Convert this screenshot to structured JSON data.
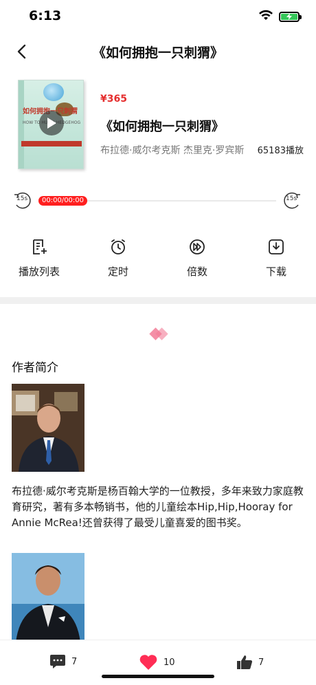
{
  "status_bar": {
    "time": "6:13",
    "icons": [
      "wifi-icon",
      "battery-charging-icon"
    ],
    "battery_color": "#35c759"
  },
  "nav": {
    "back_icon": "chevron-left-icon",
    "title": "《如何拥抱一只刺猬》"
  },
  "book": {
    "cover_title": "如何拥抱一只刺猬",
    "cover_subtitle": "HOW TO HUG A HEDGEHOG",
    "price": "¥365",
    "title": "《如何拥抱一只刺猬》",
    "authors": "布拉德·威尔考克斯 杰里克·罗宾斯",
    "plays": "65183播放",
    "accent_color": "#e52e2e"
  },
  "player": {
    "skip_back_label": "15s",
    "skip_forward_label": "15s",
    "time": "00:00/00:00",
    "progress": 0
  },
  "actions": [
    {
      "icon": "playlist-icon",
      "label": "播放列表"
    },
    {
      "icon": "timer-icon",
      "label": "定时"
    },
    {
      "icon": "speed-icon",
      "label": "倍数"
    },
    {
      "icon": "download-icon",
      "label": "下载"
    }
  ],
  "author_section": {
    "title": "作者简介",
    "bio": "布拉德·威尔考克斯是杨百翰大学的一位教授，多年来致力家庭教育研究，著有多本畅销书，他的儿童绘本Hip,Hip,Hooray for Annie McRea!还曾获得了最受儿童喜爱的图书奖。"
  },
  "bottom_bar": {
    "comments": "7",
    "likes": "10",
    "thumbs": "7",
    "like_color": "#ff2d55"
  }
}
